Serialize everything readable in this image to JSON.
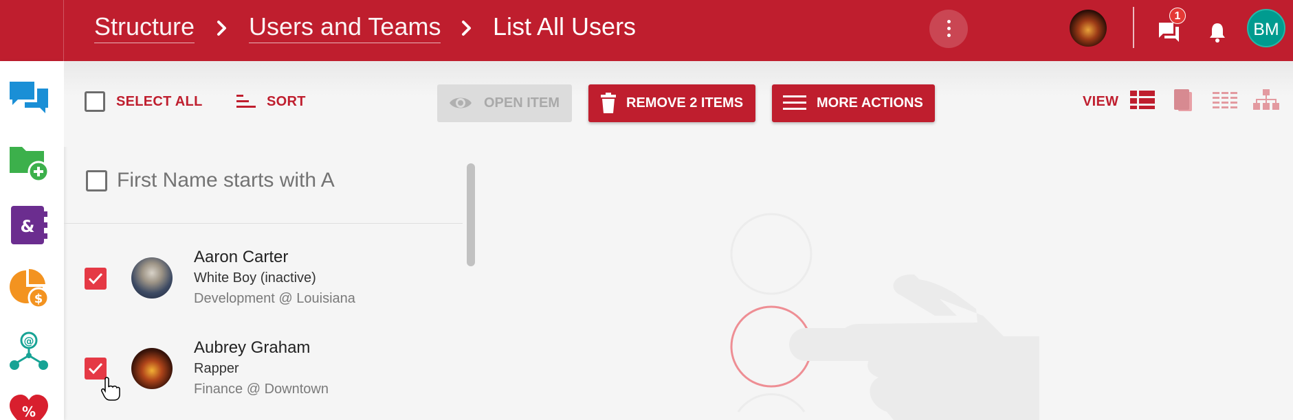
{
  "header": {
    "breadcrumb": [
      "Structure",
      "Users and Teams",
      "List All Users"
    ],
    "chat_badge_count": "1",
    "user_initials": "BM"
  },
  "sidebar": {
    "icons": [
      "chat-bubbles-icon",
      "folder-add-icon",
      "address-book-icon",
      "pie-chart-dollar-icon",
      "email-network-icon",
      "heart-percent-icon"
    ],
    "colors": [
      "#1a8fd6",
      "#3cb04b",
      "#6b2d8f",
      "#f39320",
      "#17a395",
      "#d81f2e"
    ]
  },
  "toolbar": {
    "select_all": "SELECT ALL",
    "sort": "SORT",
    "open_item": "OPEN ITEM",
    "remove_items": "REMOVE 2 ITEMS",
    "more_actions": "MORE ACTIONS",
    "view_label": "VIEW",
    "view_modes": [
      "detail-list-view-icon",
      "card-view-icon",
      "table-view-icon",
      "org-chart-view-icon"
    ]
  },
  "list": {
    "filter_label": "First Name starts with A",
    "items": [
      {
        "name": "Aaron Carter",
        "role": "White Boy (inactive)",
        "department": "Development @ Louisiana",
        "checked": true
      },
      {
        "name": "Aubrey Graham",
        "role": "Rapper",
        "department": "Finance @ Downtown",
        "checked": true
      }
    ]
  },
  "colors": {
    "brand": "#bf1e2e",
    "checkbox_checked": "#e53945",
    "avatar_teal": "#009b8f"
  }
}
